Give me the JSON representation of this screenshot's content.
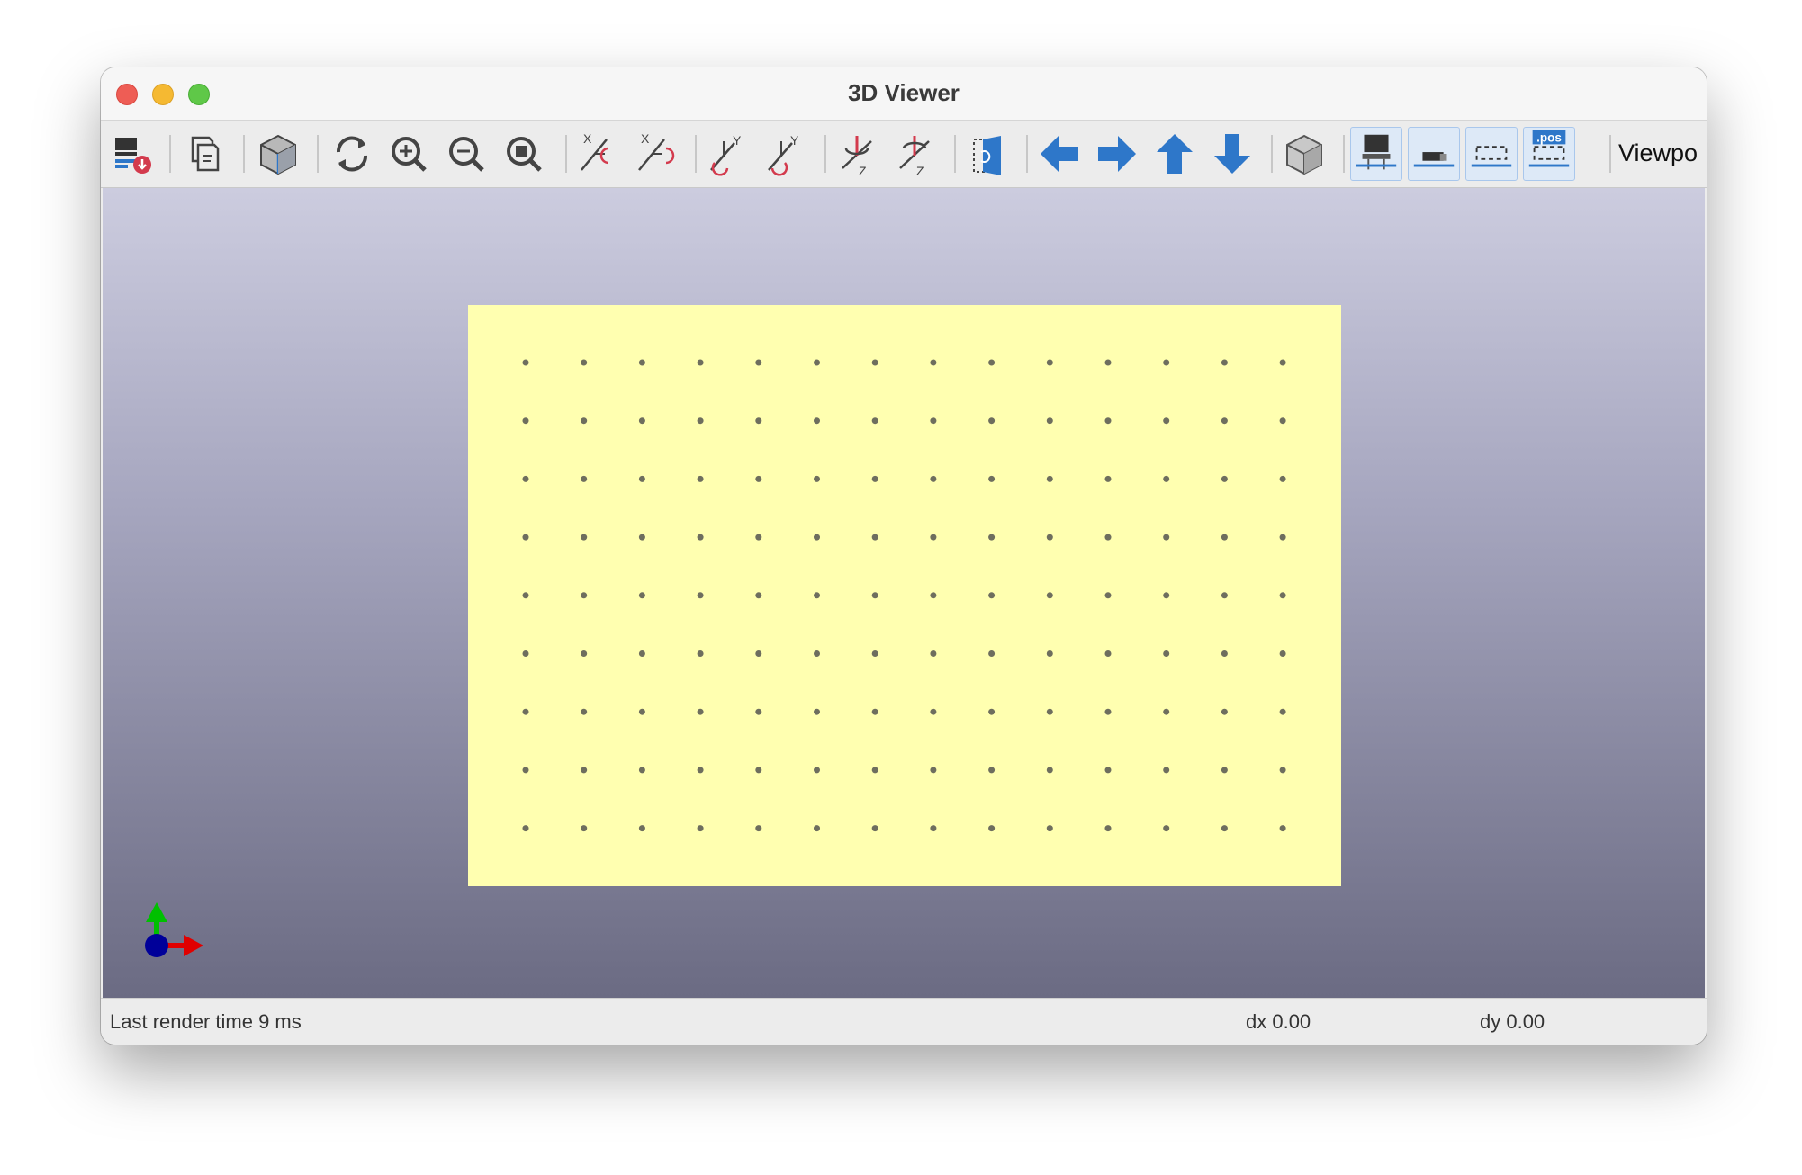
{
  "window": {
    "title": "3D Viewer"
  },
  "toolbar": {
    "buttons": [
      {
        "icon": "reload-board-icon",
        "tooltip": ""
      },
      {
        "icon": "copy-clipboard-icon",
        "tooltip": ""
      },
      {
        "icon": "render-options-icon",
        "tooltip": ""
      },
      {
        "icon": "redraw-icon",
        "tooltip": ""
      },
      {
        "icon": "zoom-in-icon",
        "tooltip": ""
      },
      {
        "icon": "zoom-out-icon",
        "tooltip": ""
      },
      {
        "icon": "zoom-fit-icon",
        "tooltip": ""
      },
      {
        "icon": "rotate-x-cw-icon",
        "label": "X"
      },
      {
        "icon": "rotate-x-ccw-icon",
        "label": "X"
      },
      {
        "icon": "rotate-y-cw-icon",
        "label": "Y"
      },
      {
        "icon": "rotate-y-ccw-icon",
        "label": "Y"
      },
      {
        "icon": "rotate-z-cw-icon",
        "label": "Z"
      },
      {
        "icon": "rotate-z-ccw-icon",
        "label": "Z"
      },
      {
        "icon": "flip-board-icon",
        "tooltip": ""
      },
      {
        "icon": "pan-left-icon",
        "tooltip": ""
      },
      {
        "icon": "pan-right-icon",
        "tooltip": ""
      },
      {
        "icon": "pan-up-icon",
        "tooltip": ""
      },
      {
        "icon": "pan-down-icon",
        "tooltip": ""
      },
      {
        "icon": "orthographic-icon",
        "tooltip": ""
      },
      {
        "icon": "show-tht-icon",
        "active": true
      },
      {
        "icon": "show-smd-icon",
        "active": true
      },
      {
        "icon": "show-virtual-icon",
        "active": true
      },
      {
        "icon": "show-not-in-pos-icon",
        "active": true,
        "badge": ".pos"
      }
    ],
    "viewports_label": "Viewpo"
  },
  "viewport": {
    "board_color": "#ffffb0",
    "background_top": "#ccccdf",
    "background_bottom": "#6b6b83",
    "hole_grid": {
      "columns": 14,
      "rows": 9
    },
    "axis_colors": {
      "x": "#e00000",
      "y": "#00c000",
      "z": "#000099"
    }
  },
  "status": {
    "render_time": "Last render time 9 ms",
    "dx": "dx 0.00",
    "dy": "dy 0.00"
  }
}
